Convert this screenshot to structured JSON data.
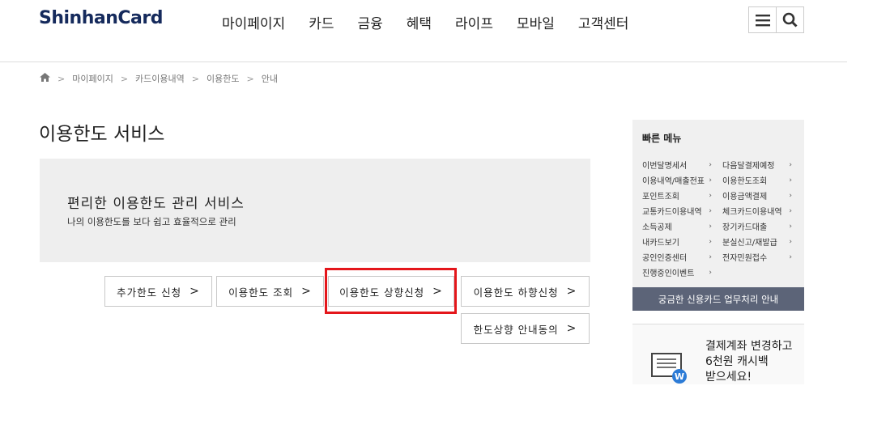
{
  "header": {
    "logo": "ShinhanCard",
    "nav": [
      "마이페이지",
      "카드",
      "금융",
      "혜택",
      "라이프",
      "모바일",
      "고객센터"
    ],
    "menu_icon": "hamburger-icon",
    "search_icon": "search-icon"
  },
  "breadcrumb": [
    "마이페이지",
    "카드이용내역",
    "이용한도",
    "안내"
  ],
  "page_title": "이용한도 서비스",
  "banner": {
    "heading": "편리한 이용한도 관리 서비스",
    "subtext": "나의 이용한도를 보다 쉽고 효율적으로 관리"
  },
  "buttons": {
    "b1": "추가한도 신청",
    "b2": "이용한도 조회",
    "b3": "이용한도 상향신청",
    "b4": "이용한도 하향신청",
    "b5": "한도상향 안내동의"
  },
  "quick_menu": {
    "title": "빠른 메뉴",
    "col1": [
      "이번달명세서",
      "이용내역/매출전표",
      "포인트조회",
      "교통카드이용내역",
      "소득공제",
      "내카드보기",
      "공인인증센터",
      "진행중인이벤트"
    ],
    "col2": [
      "다음달결제예정",
      "이용한도조회",
      "이용금액결제",
      "체크카드이용내역",
      "장기카드대출",
      "분실신고/재발급",
      "전자민원접수"
    ],
    "footer": "궁금한 신용카드 업무처리 안내"
  },
  "promo": {
    "line1": "결제계좌 변경하고",
    "line2": "6천원 캐시백",
    "line3": "받으세요!"
  },
  "colors": {
    "brand": "#152a5c",
    "highlight": "#e4161b",
    "quick_footer": "#5c6478"
  }
}
